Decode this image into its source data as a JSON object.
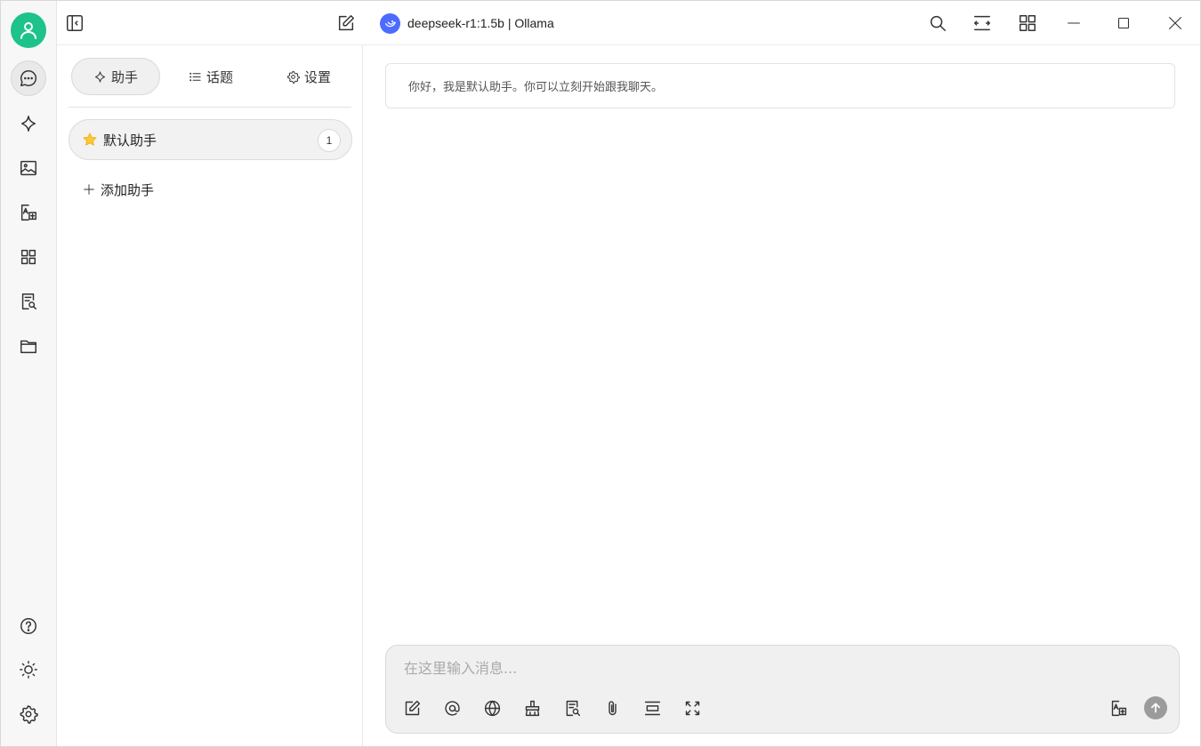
{
  "title_bar": {
    "model_label": "deepseek-r1:1.5b | Ollama"
  },
  "rail": {
    "items": [
      {
        "icon": "chat-bubble-icon",
        "active": true
      },
      {
        "icon": "sparkle-icon"
      },
      {
        "icon": "image-icon"
      },
      {
        "icon": "translate-icon"
      },
      {
        "icon": "apps-grid-icon"
      },
      {
        "icon": "knowledge-search-icon"
      },
      {
        "icon": "folder-icon"
      }
    ],
    "bottom_items": [
      {
        "icon": "help-icon"
      },
      {
        "icon": "theme-sun-icon"
      },
      {
        "icon": "settings-gear-icon"
      }
    ]
  },
  "panel": {
    "tabs": [
      {
        "label": "助手",
        "active": true
      },
      {
        "label": "话题"
      },
      {
        "label": "设置"
      }
    ],
    "assistants": [
      {
        "emoji": "star",
        "name": "默认助手",
        "count": "1"
      }
    ],
    "add_assistant_label": "添加助手"
  },
  "chat": {
    "greeting": "你好，我是默认助手。你可以立刻开始跟我聊天。",
    "composer_placeholder": "在这里输入消息..."
  },
  "colors": {
    "accent_green": "#1ec28b",
    "deepseek_blue": "#4d6bfe",
    "send_gray": "#9b9b9b"
  }
}
